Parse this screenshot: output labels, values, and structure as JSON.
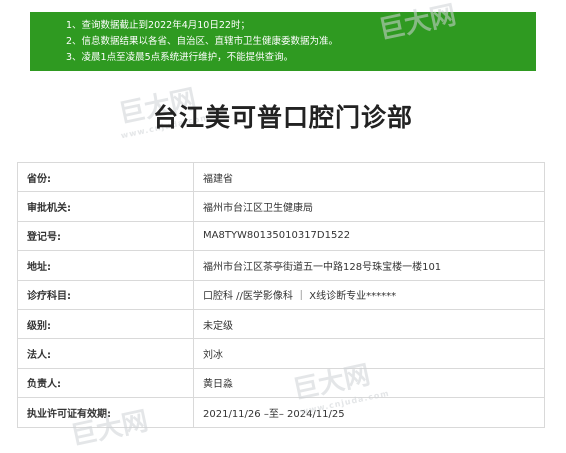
{
  "notice": {
    "lines": [
      "1、查询数据截止到2022年4月10日22时；",
      "2、信息数据结果以各省、自治区、直辖市卫生健康委数据为准。",
      "3、凌晨1点至凌晨5点系统进行维护，不能提供查询。"
    ],
    "background_color": "#2f9a21"
  },
  "page_title": "台江美可普口腔门诊部",
  "watermark": {
    "text": "巨大网",
    "url": "www.cnjuda.com"
  },
  "rows": [
    {
      "label": "省份:",
      "value": "福建省"
    },
    {
      "label": "审批机关:",
      "value": "福州市台江区卫生健康局"
    },
    {
      "label": "登记号:",
      "value": "MA8TYW80135010317D1522"
    },
    {
      "label": "地址:",
      "value": "福州市台江区茶亭街道五一中路128号珠宝楼一楼101"
    },
    {
      "label": "诊疗科目:",
      "value": "口腔科 //医学影像科 ｜ X线诊断专业******"
    },
    {
      "label": "级别:",
      "value": "未定级"
    },
    {
      "label": "法人:",
      "value": "刘冰"
    },
    {
      "label": "负责人:",
      "value": "黄日淼"
    },
    {
      "label": "执业许可证有效期:",
      "value": "2021/11/26 –至– 2024/11/25"
    }
  ]
}
